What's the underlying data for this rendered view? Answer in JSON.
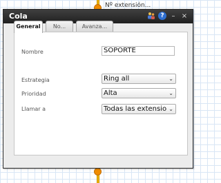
{
  "canvas": {
    "extension_label": "Nº extensión..."
  },
  "dialog": {
    "title": "Cola",
    "icons": [
      "agents-icon",
      "help-icon",
      "minimize-icon",
      "close-icon"
    ],
    "tabs": [
      {
        "label": "General",
        "active": true
      },
      {
        "label": "No...",
        "active": false
      },
      {
        "label": "Avanza...",
        "active": false
      }
    ],
    "form": {
      "name_label": "Nombre",
      "name_value": "SOPORTE",
      "strategy_label": "Estrategia",
      "strategy_value": "Ring all",
      "priority_label": "Prioridad",
      "priority_value": "Alta",
      "call_label": "Llamar a",
      "call_value": "Todas las extensiones"
    }
  },
  "colors": {
    "titlebar": "#2b2b2b",
    "connector": "#f0b400",
    "knob": "#f08c00",
    "grid": "#d9e6f5"
  }
}
